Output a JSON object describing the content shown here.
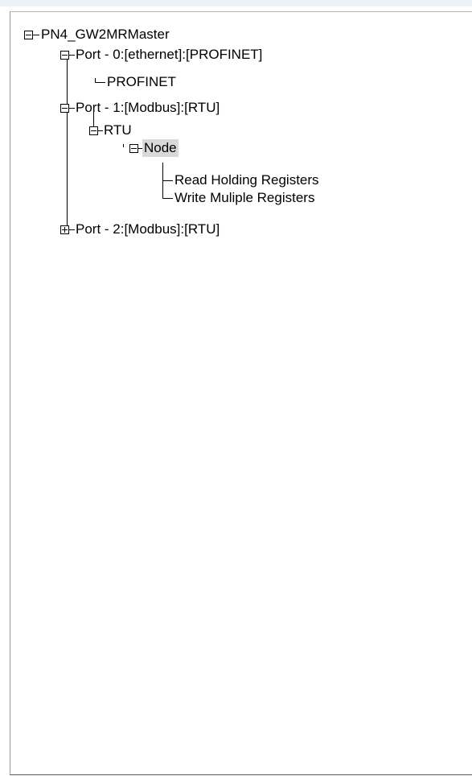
{
  "tree": {
    "root": {
      "label": "PN4_GW2MRMaster",
      "state": "expanded"
    },
    "port0": {
      "label": "Port - 0:[ethernet]:[PROFINET]",
      "state": "expanded",
      "children": {
        "profinet": {
          "label": "PROFINET"
        }
      }
    },
    "port1": {
      "label": "Port - 1:[Modbus]:[RTU]",
      "state": "expanded",
      "rtu": {
        "label": "RTU",
        "state": "expanded",
        "node": {
          "label": "Node",
          "state": "expanded",
          "selected": true,
          "items": [
            {
              "label": "Read Holding Registers"
            },
            {
              "label": "Write Muliple Registers"
            }
          ]
        }
      }
    },
    "port2": {
      "label": "Port - 2:[Modbus]:[RTU]",
      "state": "collapsed"
    }
  },
  "colors": {
    "selection": "#d9d9d9",
    "lines": "#000000",
    "border": "#5a5a5a"
  }
}
